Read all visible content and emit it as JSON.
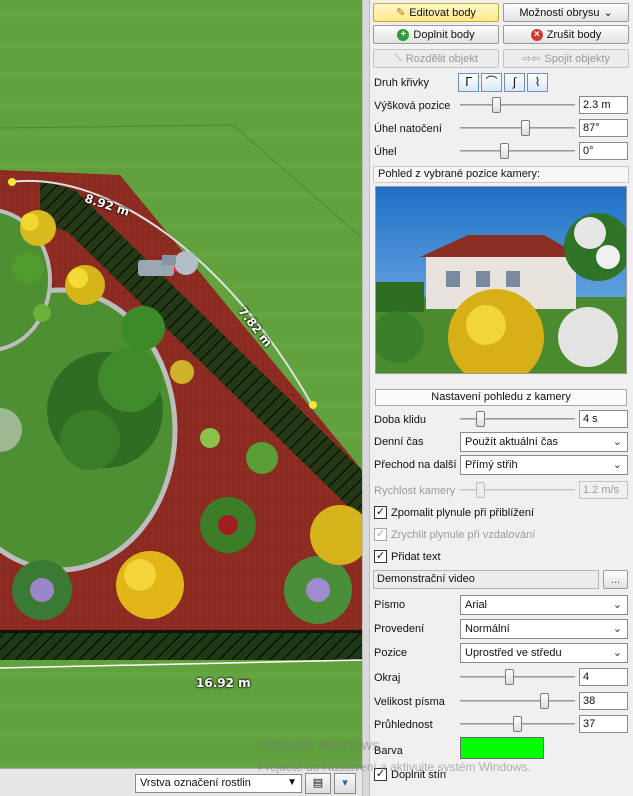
{
  "toolbar": {
    "edit_points": "Editovat body",
    "outline_options": "Možnosti obrysu",
    "add_points": "Doplnit body",
    "cancel_points": "Zrušit body",
    "split_object": "Rozdělit objekt",
    "join_objects": "Spojit objekty"
  },
  "curve": {
    "label": "Druh křivky",
    "types": [
      "curve-type-1",
      "curve-type-2",
      "curve-type-3",
      "curve-type-4"
    ]
  },
  "camera_position": {
    "height_label": "Výšková pozice",
    "height_value": "2.3 m",
    "height_fraction": 0.3,
    "rotation_label": "Úhel natočení",
    "rotation_value": "87°",
    "rotation_fraction": 0.58,
    "angle_label": "Úhel",
    "angle_value": "0°",
    "angle_fraction": 0.38
  },
  "preview": {
    "title": "Pohled z vybrané pozice kamery:"
  },
  "camera_view": {
    "section_title": "Nastavení pohledu z kamery",
    "rest_label": "Doba klidu",
    "rest_value": "4 s",
    "rest_fraction": 0.15,
    "daytime_label": "Denní čas",
    "daytime_value": "Použít aktuální čas",
    "transition_label": "Přechod na další",
    "transition_value": "Přímý střih",
    "speed_label": "Rychlost kamery",
    "speed_value": "1.2 m/s",
    "speed_fraction": 0.15,
    "slow_approach": "Zpomalit plynule při přiblížení",
    "slow_approach_checked": "✓",
    "speed_up": "Zrychlit plynule při vzdalování",
    "speed_up_checked": "✓",
    "add_text": "Přidat text",
    "add_text_checked": "✓",
    "text_value": "Demonstrační video",
    "browse": "..."
  },
  "text_settings": {
    "font_label": "Písmo",
    "font_value": "Arial",
    "style_label": "Provedení",
    "style_value": "Normální",
    "position_label": "Pozice",
    "position_value": "Uprostřed ve středu",
    "margin_label": "Okraj",
    "margin_value": "4",
    "margin_fraction": 0.42,
    "size_label": "Velikost písma",
    "size_value": "38",
    "size_fraction": 0.75,
    "opacity_label": "Průhlednost",
    "opacity_value": "37",
    "opacity_fraction": 0.5,
    "color_label": "Barva",
    "color": "#00ff00",
    "fill_shadow": "Doplnit stín",
    "fill_shadow_checked": "✓"
  },
  "viewport": {
    "dim_1": "8.92 m",
    "dim_2": "7.82 m",
    "dim_3": "16.92 m",
    "layer": "Vrstva označení rostlin"
  },
  "watermark": {
    "line1": "Aktivujte Windows",
    "line2": "Přejděte do Nastavení a aktivujte systém Windows."
  }
}
